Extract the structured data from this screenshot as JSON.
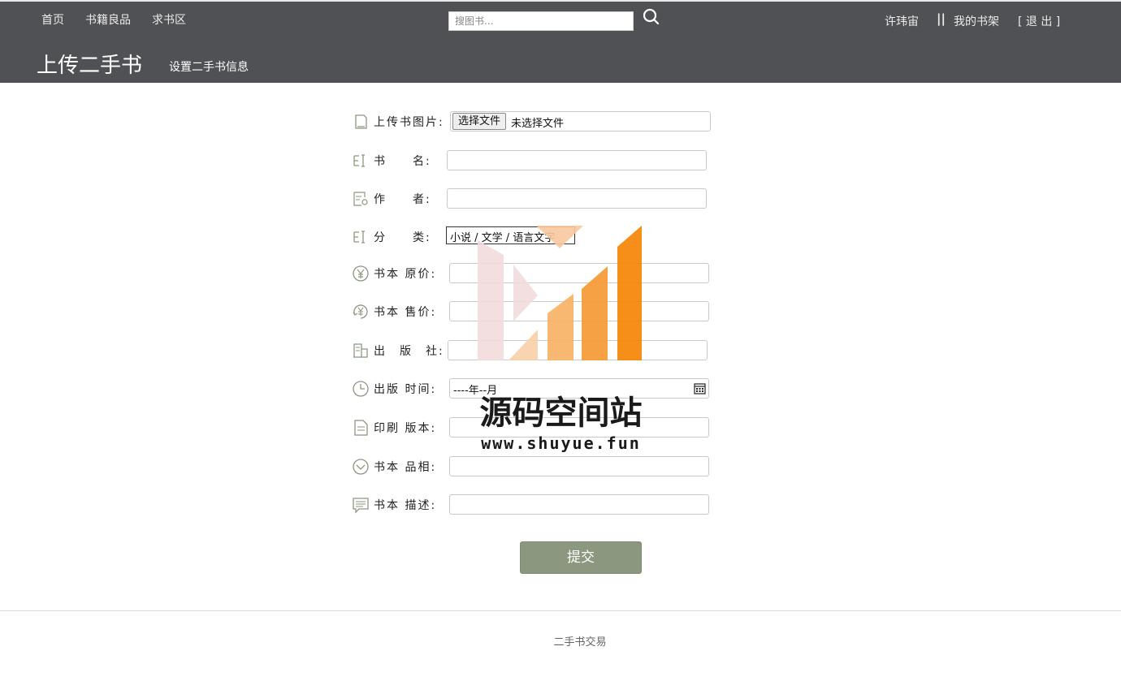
{
  "nav": {
    "home": "首页",
    "good_books": "书籍良品",
    "wanted": "求书区"
  },
  "search": {
    "placeholder": "搜图书..."
  },
  "user": {
    "name": "许玮宙",
    "separator": "||",
    "bookshelf": "我的书架",
    "logout": "[ 退 出 ]"
  },
  "page": {
    "title": "上传二手书",
    "subtitle": "设置二手书信息"
  },
  "form": {
    "image": {
      "label": "上传书图片:",
      "button": "选择文件",
      "status": "未选择文件"
    },
    "name": {
      "label": "书　　名:",
      "value": ""
    },
    "author": {
      "label": "作　　者:",
      "value": ""
    },
    "category": {
      "label": "分　　类:",
      "selected": "小说 / 文学 / 语言文字"
    },
    "original_price": {
      "label": "书本 原价:",
      "value": ""
    },
    "sale_price": {
      "label": "书本 售价:",
      "value": ""
    },
    "publisher": {
      "label": "出　版　社:",
      "value": ""
    },
    "publish_date": {
      "label": "出版 时间:",
      "value": "----年--月"
    },
    "edition": {
      "label": "印刷 版本:",
      "value": ""
    },
    "condition": {
      "label": "书本 品相:",
      "value": ""
    },
    "description": {
      "label": "书本 描述:",
      "value": ""
    },
    "submit": "提交"
  },
  "footer": {
    "text": "二手书交易"
  },
  "watermark": {
    "title": "源码空间站",
    "url": "www.shuyue.fun"
  },
  "colors": {
    "header_bg": "#505155",
    "submit_bg": "#8c9780",
    "icon": "#8c9780"
  }
}
